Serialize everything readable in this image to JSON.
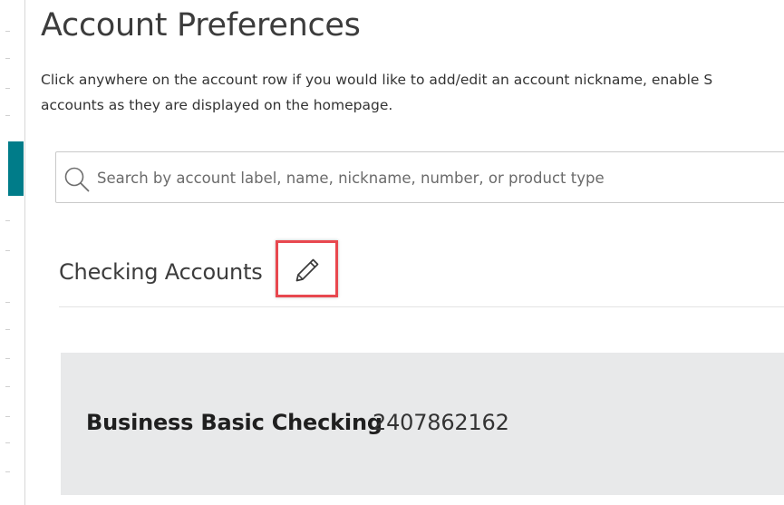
{
  "page": {
    "title": "Account Preferences",
    "intro_line1": "Click anywhere on the account row if you would like to add/edit an account nickname, enable S",
    "intro_line2": "accounts as they are displayed on the homepage."
  },
  "search": {
    "placeholder": "Search by account label, name, nickname, number, or product type",
    "icon": "search-icon"
  },
  "section": {
    "heading": "Checking Accounts",
    "edit_icon": "pencil-icon"
  },
  "accounts": [
    {
      "name": "Business Basic Checking",
      "number": "2407862162"
    }
  ],
  "colors": {
    "accent": "#007c89",
    "highlight": "#e8484f",
    "row_background": "#e8e9ea"
  }
}
